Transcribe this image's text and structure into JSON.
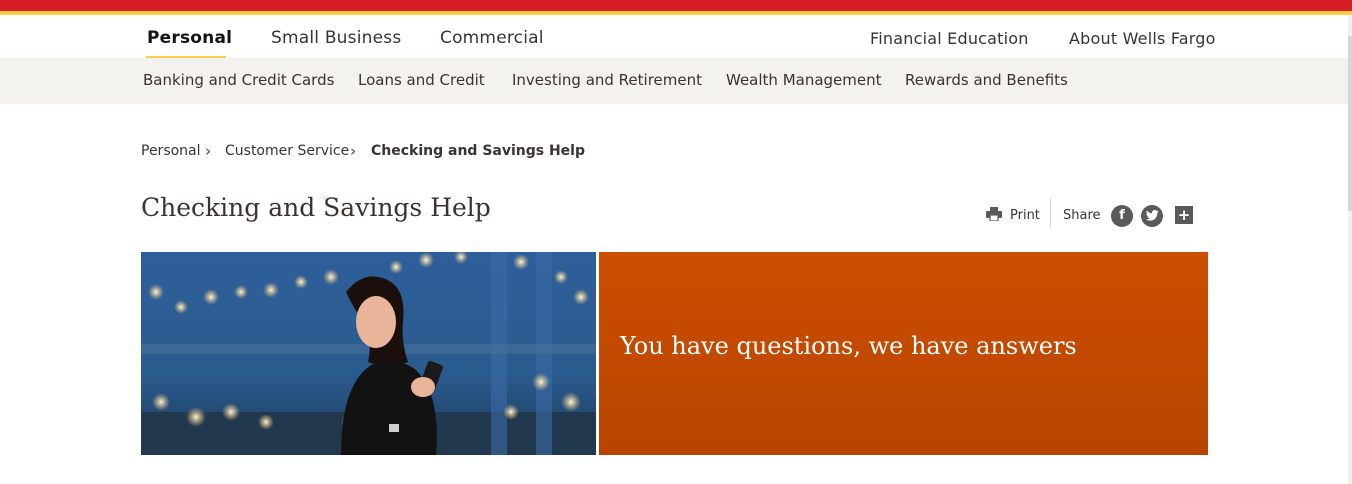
{
  "colors": {
    "brand_red": "#d71e28",
    "brand_gold": "#ffcd41",
    "hero_panel": "#c44a00"
  },
  "top_nav": {
    "left": [
      "Personal",
      "Small Business",
      "Commercial"
    ],
    "right": [
      "Financial Education",
      "About Wells Fargo"
    ],
    "active": "Personal"
  },
  "sub_nav": [
    "Banking and Credit Cards",
    "Loans and Credit",
    "Investing and Retirement",
    "Wealth Management",
    "Rewards and Benefits"
  ],
  "breadcrumb": {
    "items": [
      "Personal",
      "Customer Service"
    ],
    "current": "Checking and Savings Help"
  },
  "page": {
    "title": "Checking and Savings Help"
  },
  "utilities": {
    "print_label": "Print",
    "share_label": "Share",
    "icons": [
      "printer-icon",
      "facebook-icon",
      "twitter-icon",
      "plus-icon"
    ]
  },
  "hero": {
    "image_description_icon": "photo-woman-with-phone",
    "headline": "You have questions, we have answers"
  }
}
